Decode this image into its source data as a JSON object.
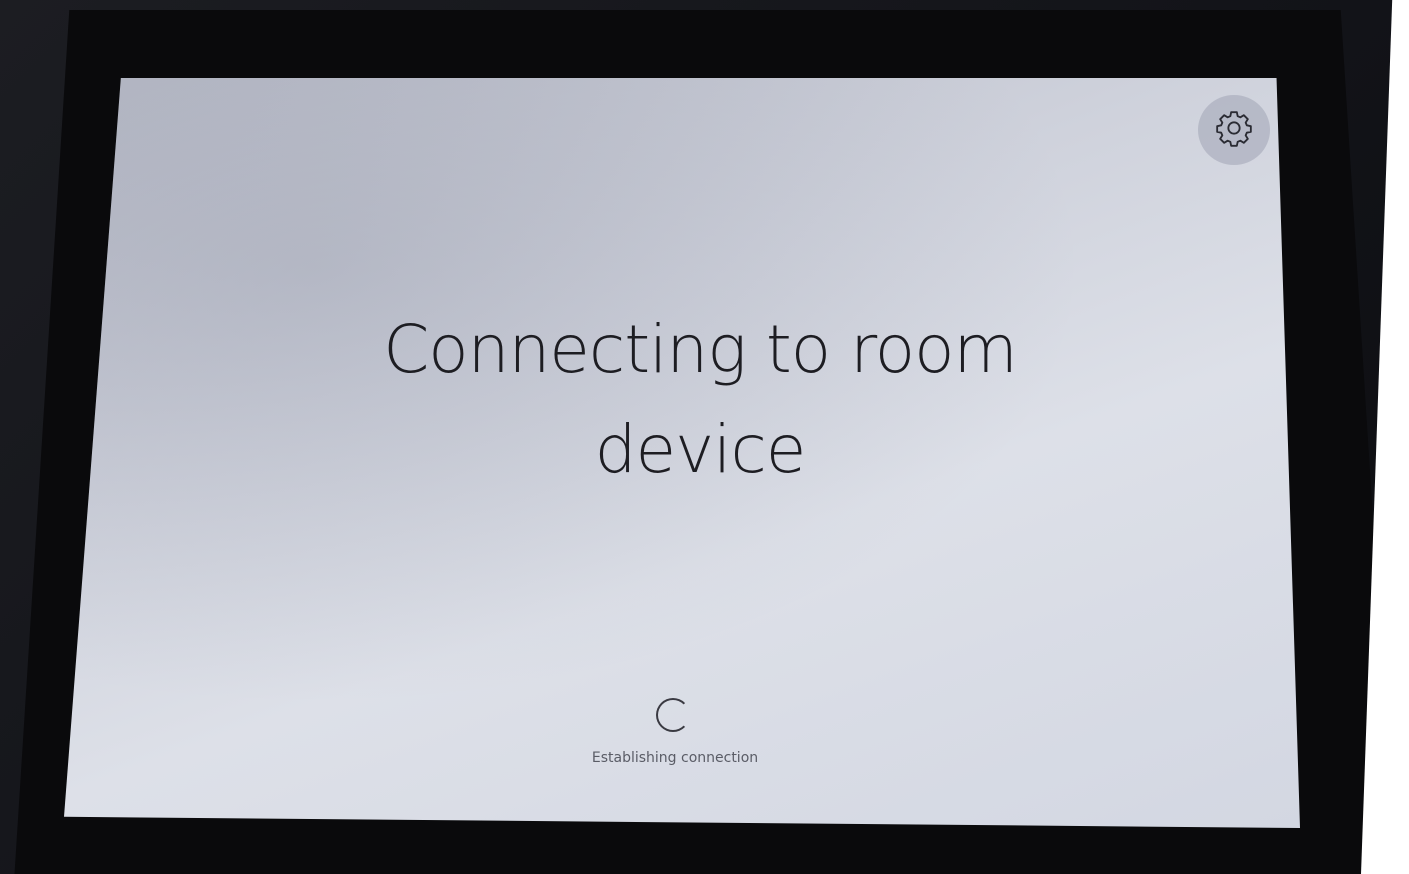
{
  "screen": {
    "title": "Connecting to room device",
    "status_text": "Establishing connection",
    "settings_icon": "gear-icon",
    "spinner_icon": "loading-spinner-icon"
  },
  "colors": {
    "screen_bg": "#d3d7e2",
    "text": "#1d1d22",
    "settings_button_bg": "#a0a4b4"
  }
}
